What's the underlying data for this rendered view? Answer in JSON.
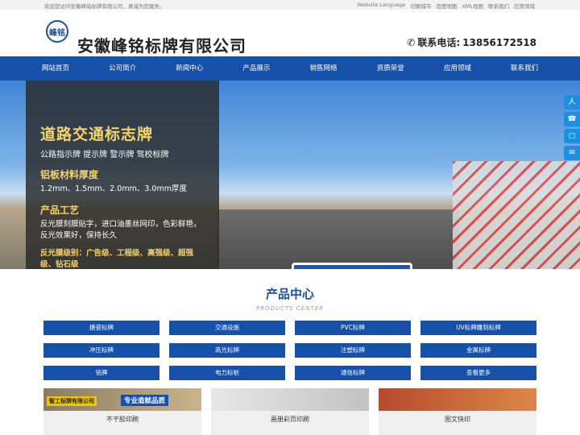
{
  "topbar": {
    "welcome": "欢迎您访问安徽峰铭标牌有限公司，真诚为您服务。",
    "links": [
      "Website Language",
      "切换城市",
      "百度地图",
      "XML地图",
      "联系我们",
      "应用领域"
    ]
  },
  "header": {
    "logo_text": "峰铭",
    "company_name": "安徽峰铭标牌有限公司",
    "hotline_label": "联系电话:",
    "hotline_number": "13856172518"
  },
  "nav": [
    "网站首页",
    "公司简介",
    "新闻中心",
    "产品展示",
    "销售网络",
    "资质荣誉",
    "应用领域",
    "联系我们"
  ],
  "banner": {
    "title": "道路交通标志牌",
    "subtitle": "公路指示牌 提示牌 警示牌 驾校标牌",
    "material_heading": "铝板材料厚度",
    "material_text": "1.2mm、1.5mm、2.0mm、3.0mm厚度",
    "craft_heading": "产品工艺",
    "craft_text": "反光膜刻膜贴字，进口油墨丝网印，色彩鲜艳，反光效果好，保持长久",
    "grade_text": "反光膜级别：广告级、工程级、高强级、超强级、钻石级"
  },
  "side_tools": [
    "人",
    "☎",
    "▢",
    "✉"
  ],
  "products": {
    "title": "产品中心",
    "subtitle": "PRODUCTS CENTER",
    "categories": [
      "搪瓷标牌",
      "交通设施",
      "PVC标牌",
      "UV标牌雕刻标牌",
      "冲压标牌",
      "高光标牌",
      "注塑标牌",
      "金属标牌",
      "铭牌",
      "电力标桩",
      "通信标牌",
      "查看更多"
    ],
    "cards": [
      {
        "caption": "不干胶印刷",
        "tag": "智工标牌有限公司",
        "tag2": "专业造就品质"
      },
      {
        "caption": "画册彩页印刷",
        "tag": "",
        "tag2": ""
      },
      {
        "caption": "图文快印",
        "tag": "",
        "tag2": ""
      }
    ]
  }
}
